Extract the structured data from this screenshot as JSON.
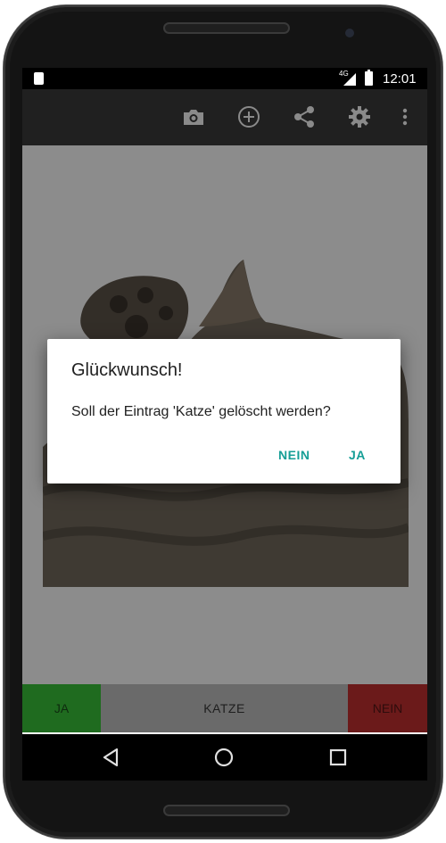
{
  "status_bar": {
    "network": "4G",
    "time": "12:01"
  },
  "toolbar": {
    "icons": [
      "camera-icon",
      "add-circle-icon",
      "share-icon",
      "gear-icon",
      "more-vert-icon"
    ]
  },
  "bottom_bar": {
    "yes_label": "JA",
    "word_label": "KATZE",
    "no_label": "NEIN",
    "yes_color": "#1f6b1f",
    "no_color": "#6b1a1a"
  },
  "dialog": {
    "title": "Glückwunsch!",
    "message": "Soll der Eintrag 'Katze' gelöscht werden?",
    "negative_label": "NEIN",
    "positive_label": "JA",
    "accent_color": "#159e96"
  },
  "nav_bar": {
    "icons": [
      "back-icon",
      "home-icon",
      "recents-icon"
    ]
  }
}
